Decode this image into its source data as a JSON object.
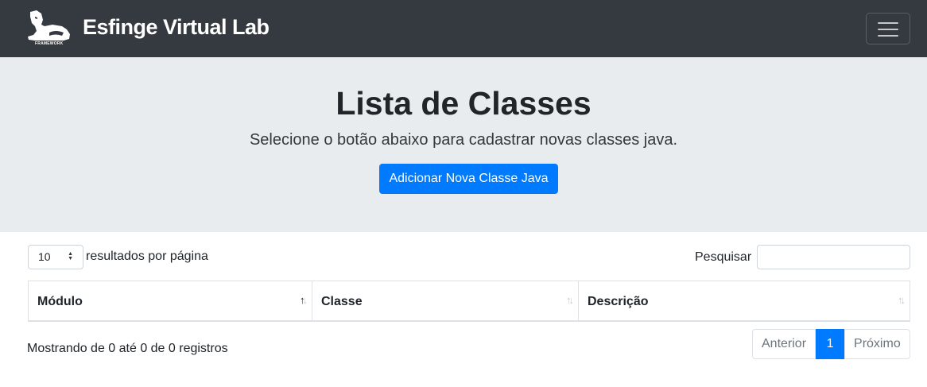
{
  "navbar": {
    "brand_name": "Esfinge Virtual Lab",
    "logo_caption": "FRAMEWORK"
  },
  "hero": {
    "title": "Lista de Classes",
    "subtitle": "Selecione o botão abaixo para cadastrar novas classes java.",
    "button_label": "Adicionar Nova Classe Java"
  },
  "table_controls": {
    "page_length": "10",
    "page_length_label": "resultados por página",
    "search_label": "Pesquisar",
    "search_value": ""
  },
  "table": {
    "columns": [
      "Módulo",
      "Classe",
      "Descrição"
    ]
  },
  "footer": {
    "info": "Mostrando de 0 até 0 de 0 registros",
    "prev": "Anterior",
    "current_page": "1",
    "next": "Próximo"
  },
  "colors": {
    "navbar": "#343a40",
    "jumbotron": "#e9ecef",
    "primary": "#007bff"
  }
}
